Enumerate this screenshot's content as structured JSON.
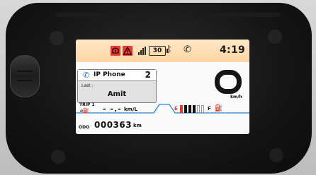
{
  "status_bar": {
    "battery_text": "30",
    "bluetooth_glyph": "ᛒ",
    "phone_glyph": "✆",
    "time": "4:19",
    "warning_color": "#e53935"
  },
  "call_card": {
    "icon_glyph": "✆",
    "title": "IP Phone",
    "count": "2",
    "last_label": "Last :",
    "last_name": "Amit"
  },
  "speedometer": {
    "unit": "km/h"
  },
  "trip": {
    "label": "TRIP 1",
    "sub": "⌀⛽",
    "value": "- -.-",
    "unit": "km/L"
  },
  "fuel": {
    "empty_label": "E",
    "full_label": "F",
    "icon_glyph": "⛽",
    "filled_bars": 4,
    "total_bars": 6
  },
  "odometer": {
    "label": "ODO",
    "value": "000363",
    "unit": "km"
  },
  "colors": {
    "topbar": "#ffd6a3",
    "accent_line": "#1e88e5",
    "fuel_low": "#e53935"
  }
}
